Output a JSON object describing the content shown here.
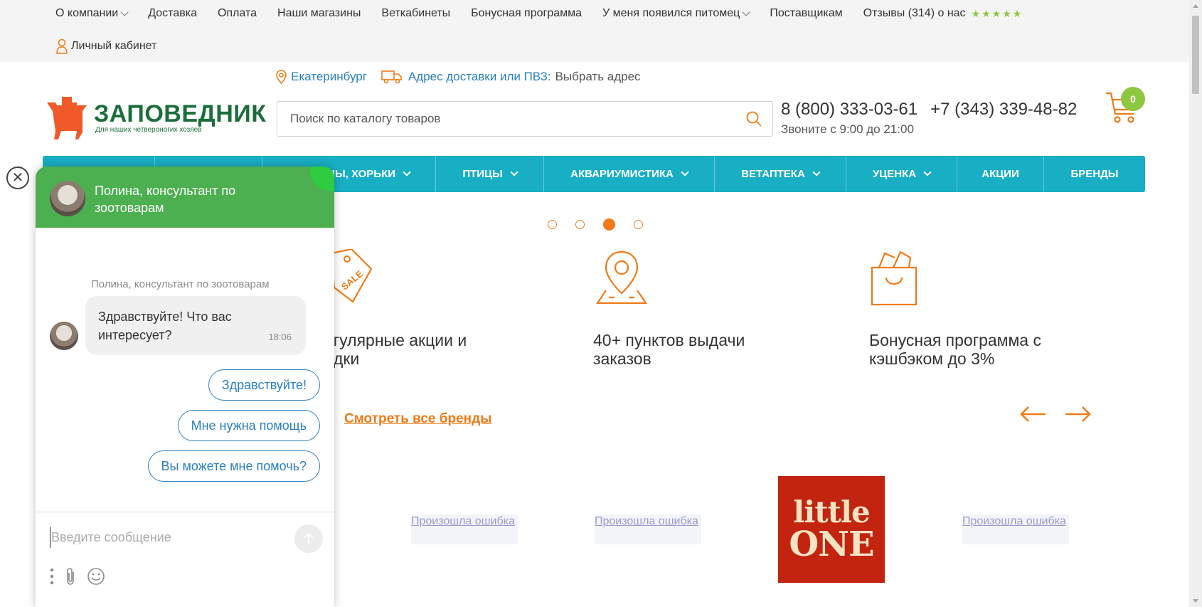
{
  "topnav": {
    "items": [
      {
        "label": "О компании",
        "dropdown": true
      },
      {
        "label": "Доставка",
        "dropdown": false
      },
      {
        "label": "Оплата",
        "dropdown": false
      },
      {
        "label": "Наши магазины",
        "dropdown": false
      },
      {
        "label": "Веткабинеты",
        "dropdown": false
      },
      {
        "label": "Бонусная программа",
        "dropdown": false
      },
      {
        "label": "У меня появился питомец",
        "dropdown": true
      },
      {
        "label": "Поставщикам",
        "dropdown": false
      }
    ],
    "reviews_label": "Отзывы (314) о нас",
    "stars": "★★★★★",
    "cabinet_label": "Личный кабинет"
  },
  "header": {
    "logo_name": "ЗАПОВЕДНИК",
    "logo_tagline": "Для наших четвероногих хозяев",
    "city": "Екатеринбург",
    "address_label": "Адрес доставки или ПВЗ:",
    "address_value": "Выбрать адрес",
    "search_placeholder": "Поиск по каталогу товаров",
    "phone1": "8 (800) 333-03-61",
    "phone2": "+7 (343) 339-48-82",
    "hours": "Звоните с 9:00 до 21:00",
    "cart_count": "0"
  },
  "mainnav": {
    "items": [
      {
        "label": "",
        "dropdown": false
      },
      {
        "label": "",
        "dropdown": false
      },
      {
        "label": "НЫ, ХОРЬКИ",
        "dropdown": true
      },
      {
        "label": "ПТИЦЫ",
        "dropdown": true
      },
      {
        "label": "АКВАРИУМИСТИКА",
        "dropdown": true
      },
      {
        "label": "ВЕТАПТЕКА",
        "dropdown": true
      },
      {
        "label": "УЦЕНКА",
        "dropdown": true
      },
      {
        "label": "АКЦИИ",
        "dropdown": false
      },
      {
        "label": "БРЕНДЫ",
        "dropdown": false
      }
    ]
  },
  "slider": {
    "active_index": 2,
    "count": 4
  },
  "features": [
    {
      "icon": "sale-tag-icon",
      "text": "егулярные акции и\nидки"
    },
    {
      "icon": "map-pin-icon",
      "text": "40+ пунктов выдачи\nзаказов"
    },
    {
      "icon": "shopping-bag-icon",
      "text": "Бонусная программа с\nкэшбэком до 3%"
    }
  ],
  "brands": {
    "see_all": "Смотреть все бренды",
    "error_text": "Произошла ошибка",
    "little_one_line1": "little",
    "little_one_line2": "ONE"
  },
  "chat": {
    "header_title": "Полина, консультант по зоотоварам",
    "sender": "Полина, консультант по зоотоварам",
    "message": "Здравствуйте! Что вас интересует?",
    "message_time": "18:06",
    "quick_replies": [
      "Здравствуйте!",
      "Мне нужна помощь",
      "Вы можете мне помочь?"
    ],
    "input_placeholder": "Введите сообщение"
  },
  "colors": {
    "brand_green": "#1b6e3a",
    "accent_orange": "#f07a16",
    "nav_teal": "#18aec4",
    "chat_green": "#4caf50",
    "link_blue": "#2a7fc0",
    "star_green": "#8dc63f"
  }
}
